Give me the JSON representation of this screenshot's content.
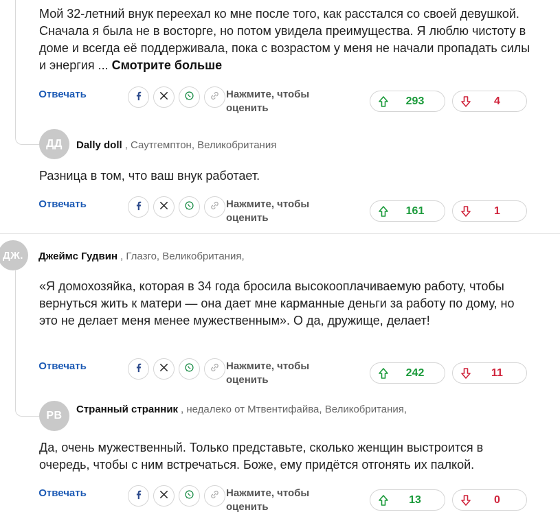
{
  "common": {
    "reply_label": "Отвечать",
    "rate_label": "Нажмите, чтобы оценить",
    "icons": [
      "facebook-icon",
      "x-icon",
      "whatsapp-icon",
      "link-icon",
      "arrow-up-icon",
      "arrow-down-icon"
    ],
    "colors": {
      "reply": "#1d5bb5",
      "upvote": "#1a9a3a",
      "downvote": "#d0243c",
      "avatar": "#c9c9c9"
    }
  },
  "comments": [
    {
      "text": "Мой 32-летний внук переехал ко мне после того, как расстался со своей девушкой. Сначала я была не в восторге, но потом увидела преимущества. Я люблю чистоту в доме и всегда её поддерживала, пока с возрастом у меня не начали пропадать силы и энергия ...",
      "more": "Смотрите больше",
      "up": "293",
      "down": "4"
    },
    {
      "initials": "ДД",
      "author": "Dally doll",
      "location": ", Саутгемптон, Великобритания",
      "text": "Разница в том, что ваш внук работает.",
      "up": "161",
      "down": "1"
    },
    {
      "initials": "ДЖ.",
      "author": "Джеймс Гудвин",
      "location": ", Глазго, Великобритания,",
      "text": "«Я домохозяйка, которая в 34 года бросила высокооплачиваемую работу, чтобы вернуться жить к матери — она дает мне карманные деньги за работу по дому, но это не делает меня менее мужественным». О да, дружище, делает!",
      "up": "242",
      "down": "11"
    },
    {
      "initials": "РВ",
      "author": "Странный странник",
      "location": ", недалеко от Мтвентифайва, Великобритания,",
      "text": "Да, очень мужественный. Только представьте, сколько женщин выстроится в очередь, чтобы с ним встречаться. Боже, ему придётся отгонять их палкой.",
      "up": "13",
      "down": "0"
    }
  ]
}
